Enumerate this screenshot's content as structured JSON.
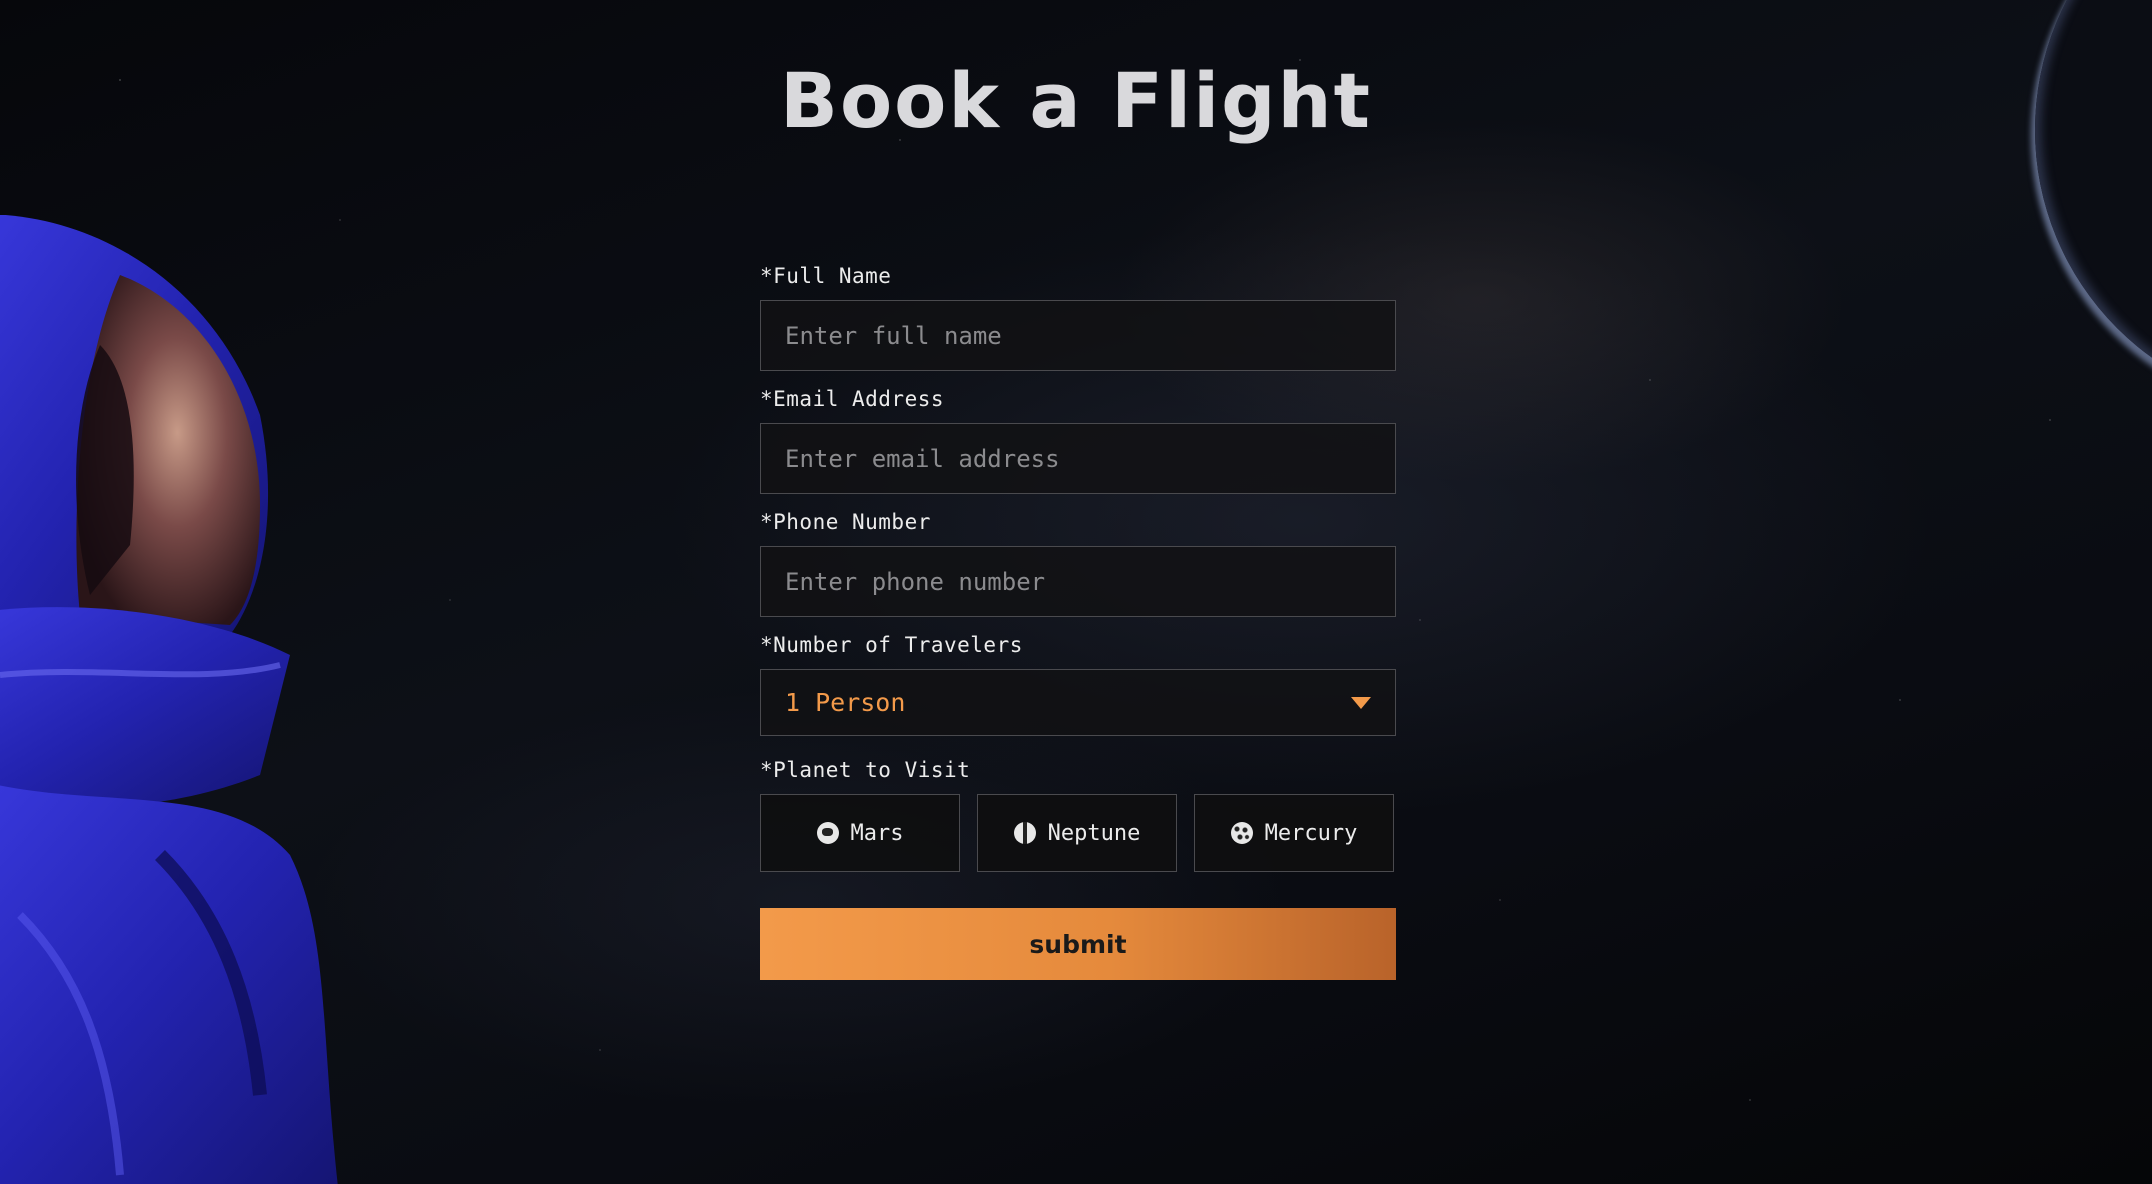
{
  "page": {
    "title": "Book a Flight"
  },
  "form": {
    "full_name": {
      "label": "*Full Name",
      "placeholder": "Enter full name",
      "value": ""
    },
    "email": {
      "label": "*Email Address",
      "placeholder": "Enter email address",
      "value": ""
    },
    "phone": {
      "label": "*Phone Number",
      "placeholder": "Enter phone number",
      "value": ""
    },
    "travelers": {
      "label": "*Number of Travelers",
      "selected": "1 Person"
    },
    "planet": {
      "label": "*Planet to Visit",
      "options": [
        {
          "label": "Mars",
          "icon": "mars-icon"
        },
        {
          "label": "Neptune",
          "icon": "neptune-icon"
        },
        {
          "label": "Mercury",
          "icon": "mercury-icon"
        }
      ]
    },
    "submit_label": "submit"
  },
  "colors": {
    "accent": "#f39a4a",
    "background": "#0a0c12",
    "astronaut_suit": "#2c2cc7"
  }
}
